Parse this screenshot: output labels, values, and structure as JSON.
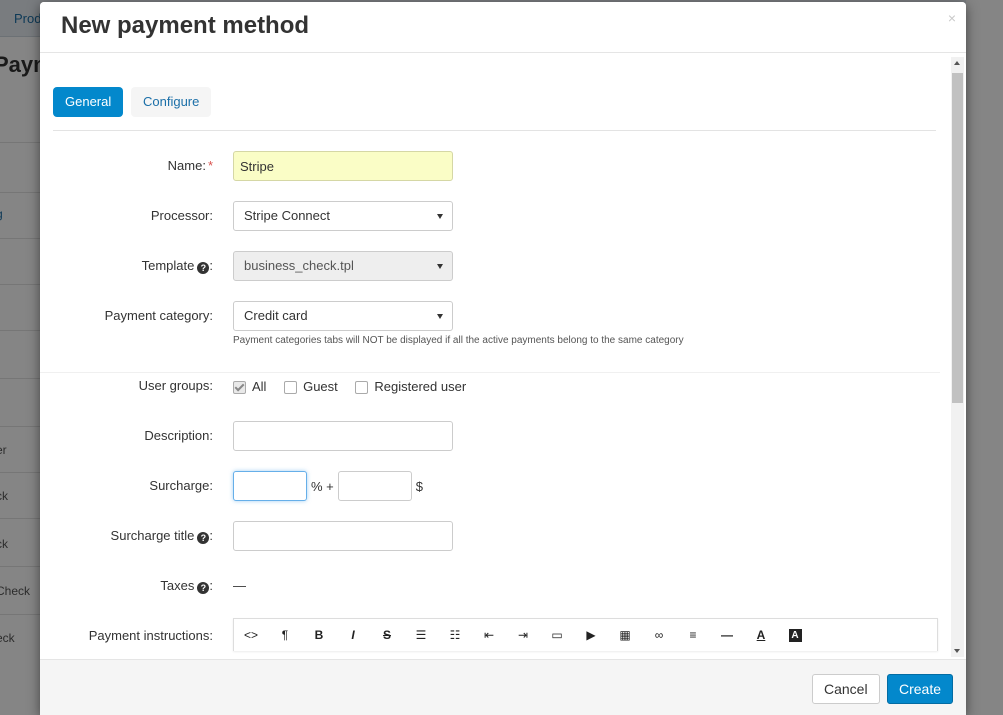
{
  "background": {
    "top_tab": "Prod",
    "heading": "Paym",
    "row_snippets": [
      "g",
      "er",
      "ck",
      "ck",
      "Check",
      "eck"
    ]
  },
  "modal": {
    "title": "New payment method",
    "close_symbol": "×",
    "tabs": [
      {
        "label": "General",
        "active": true
      },
      {
        "label": "Configure",
        "active": false
      }
    ],
    "form": {
      "name_label": "Name:",
      "name_required_mark": "*",
      "name_value": "Stripe",
      "processor_label": "Processor:",
      "processor_value": "Stripe Connect",
      "template_label": "Template",
      "template_value": "business_check.tpl",
      "payment_category_label": "Payment category:",
      "payment_category_value": "Credit card",
      "payment_category_hint": "Payment categories tabs will NOT be displayed if all the active payments belong to the same category",
      "user_groups_label": "User groups:",
      "user_groups": [
        {
          "label": "All",
          "checked": true
        },
        {
          "label": "Guest",
          "checked": false
        },
        {
          "label": "Registered user",
          "checked": false
        }
      ],
      "description_label": "Description:",
      "description_value": "",
      "surcharge_label": "Surcharge:",
      "surcharge_percent_value": "",
      "surcharge_percent_unit": "% +",
      "surcharge_fixed_value": "",
      "surcharge_currency": "$",
      "surcharge_title_label": "Surcharge title",
      "surcharge_title_value": "",
      "taxes_label": "Taxes",
      "taxes_value": "—",
      "payment_instructions_label": "Payment instructions:",
      "help_glyph": "?",
      "label_colon": ":"
    },
    "editor_toolbar": [
      {
        "icon": "code-icon",
        "glyph": "<>"
      },
      {
        "icon": "paragraph-icon",
        "glyph": "¶"
      },
      {
        "icon": "bold-icon",
        "glyph": "B"
      },
      {
        "icon": "italic-icon",
        "glyph": "I"
      },
      {
        "icon": "strikethrough-icon",
        "glyph": "S"
      },
      {
        "icon": "unordered-list-icon",
        "glyph": "☰"
      },
      {
        "icon": "ordered-list-icon",
        "glyph": "☷"
      },
      {
        "icon": "outdent-icon",
        "glyph": "⇤"
      },
      {
        "icon": "indent-icon",
        "glyph": "⇥"
      },
      {
        "icon": "image-icon",
        "glyph": "▭"
      },
      {
        "icon": "video-icon",
        "glyph": "▶"
      },
      {
        "icon": "table-icon",
        "glyph": "▦"
      },
      {
        "icon": "link-icon",
        "glyph": "∞"
      },
      {
        "icon": "align-icon",
        "glyph": "≡"
      },
      {
        "icon": "horizontal-rule-icon",
        "glyph": "—"
      },
      {
        "icon": "font-color-icon",
        "glyph": "A"
      },
      {
        "icon": "background-color-icon",
        "glyph": "A"
      }
    ],
    "footer": {
      "cancel_label": "Cancel",
      "create_label": "Create"
    }
  },
  "colors": {
    "accent": "#0388cc",
    "link": "#1b6fa8",
    "required": "#d9534f",
    "highlight_input": "#fafdc6"
  }
}
